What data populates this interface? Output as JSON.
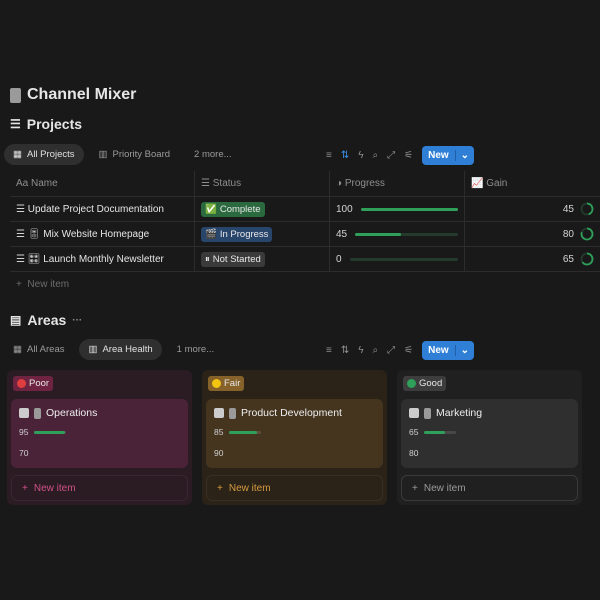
{
  "page": {
    "title": "Channel Mixer",
    "icon": "fader-icon"
  },
  "projects": {
    "heading": "Projects",
    "tabs": [
      {
        "label": "All Projects"
      },
      {
        "label": "Priority Board"
      },
      {
        "label": "2 more..."
      }
    ],
    "new_label": "New",
    "columns": [
      "Name",
      "Status",
      "Progress",
      "Gain"
    ],
    "rows": [
      {
        "name": "Update Project Documentation",
        "prefix": "",
        "status": "Complete",
        "status_icon": "✅",
        "progress": 100,
        "gain": 45
      },
      {
        "name": "Mix Website Homepage",
        "prefix": "🎚",
        "status": "In Progress",
        "status_icon": "🎬",
        "progress": 45,
        "gain": 80
      },
      {
        "name": "Launch Monthly Newsletter",
        "prefix": "🎛",
        "status": "Not Started",
        "status_icon": "⏸",
        "progress": 0,
        "gain": 65
      }
    ],
    "new_item": "New item"
  },
  "areas": {
    "heading": "Areas",
    "more": "···",
    "tabs": [
      {
        "label": "All Areas"
      },
      {
        "label": "Area Health"
      },
      {
        "label": "1 more..."
      }
    ],
    "new_label": "New",
    "groups": [
      {
        "label": "Poor",
        "dot": "#e03e3e",
        "card": {
          "title": "Operations",
          "value1": 95,
          "value2": 70
        },
        "new_item": "New item"
      },
      {
        "label": "Fair",
        "dot": "#f2c511",
        "card": {
          "title": "Product Development",
          "value1": 85,
          "value2": 90
        },
        "new_item": "New item"
      },
      {
        "label": "Good",
        "dot": "#2ea05a",
        "card": {
          "title": "Marketing",
          "value1": 65,
          "value2": 80
        },
        "new_item": "New item"
      }
    ]
  },
  "colors": {
    "accent": "#2f7fd6",
    "progress": "#2ea05a"
  }
}
